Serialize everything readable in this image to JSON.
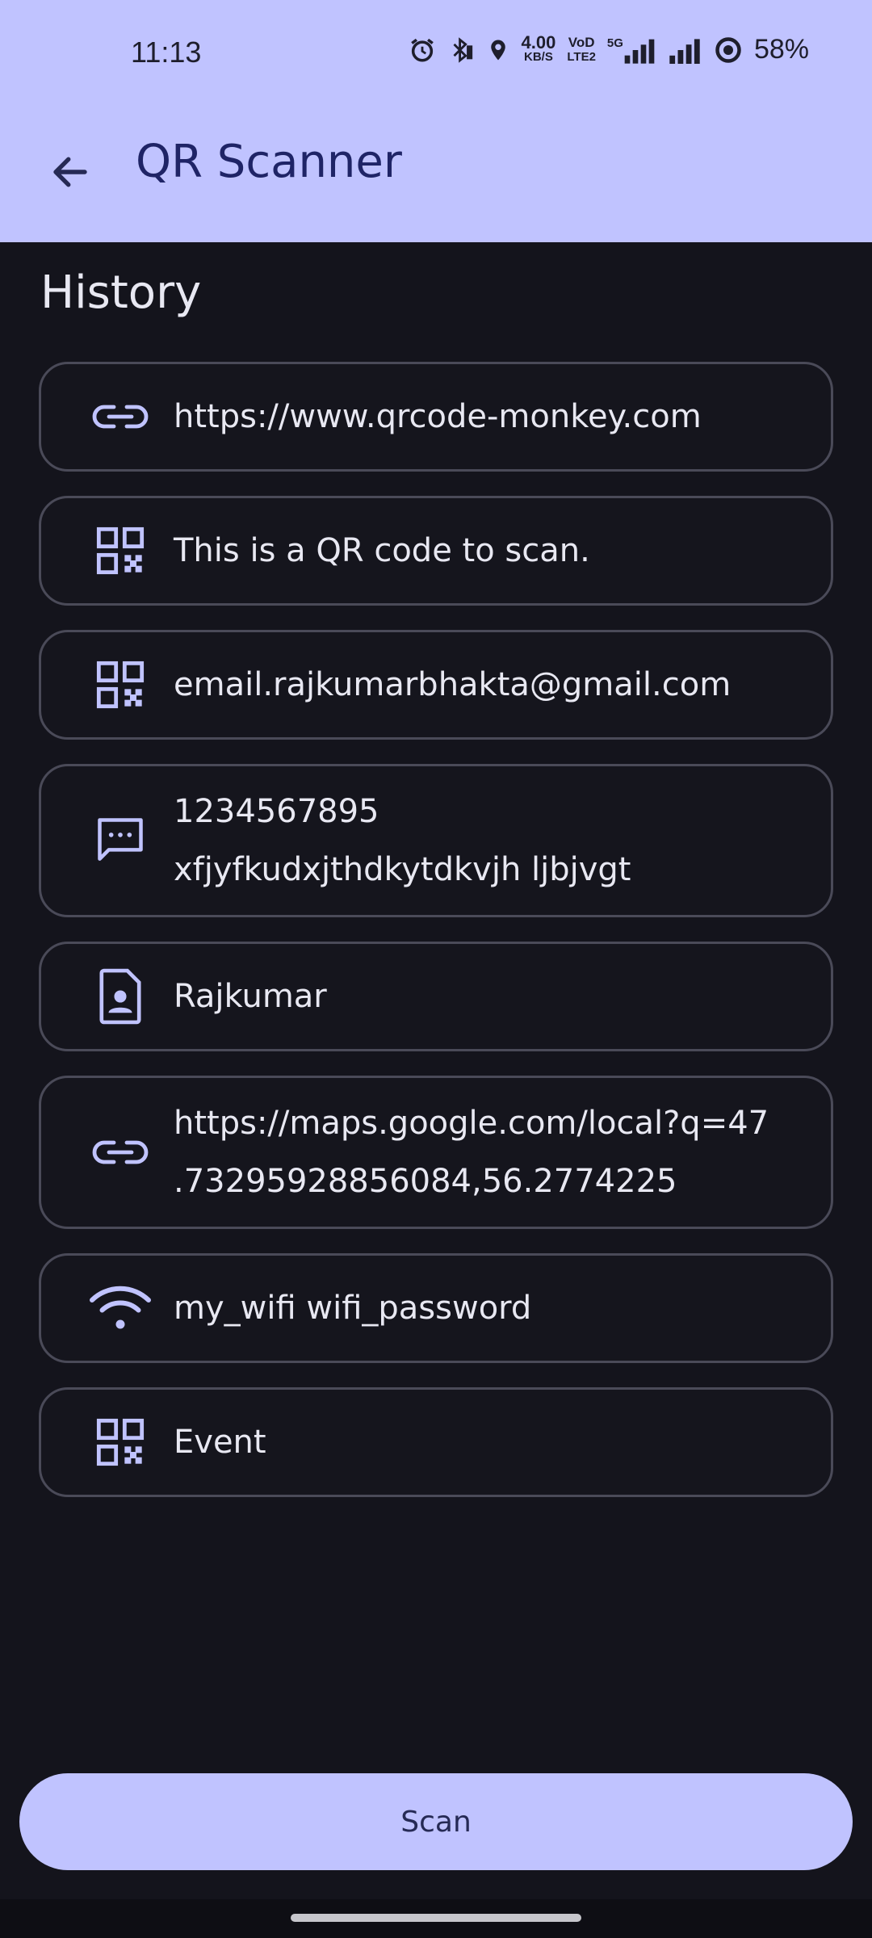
{
  "status_bar": {
    "time": "11:13",
    "net_speed_top": "4.00",
    "net_speed_bottom": "KB/S",
    "volte_top": "VoD",
    "volte_bottom": "LTE2",
    "net_type": "5G",
    "battery": "58%"
  },
  "app_bar": {
    "title": "QR Scanner",
    "back_icon": "arrow-back-icon"
  },
  "history": {
    "label": "History",
    "items": [
      {
        "icon": "link-icon",
        "text": "https://www.qrcode-monkey.com"
      },
      {
        "icon": "qr-code-icon",
        "text": "This is a QR code to scan."
      },
      {
        "icon": "qr-code-icon",
        "text": "email.rajkumarbhakta@gmail.com"
      },
      {
        "icon": "message-icon",
        "line1": "1234567895",
        "line2": "xfjyfkudxjthdkytdkvjh ljbjvgt"
      },
      {
        "icon": "contact-icon",
        "text": "Rajkumar"
      },
      {
        "icon": "link-icon",
        "line1": "https://maps.google.com/local?q=47",
        "line2": ".73295928856084,56.2774225"
      },
      {
        "icon": "wifi-icon",
        "text": "my_wifi wifi_password"
      },
      {
        "icon": "qr-code-icon",
        "text": "Event"
      }
    ]
  },
  "scan_button": {
    "label": "Scan"
  },
  "colors": {
    "accent": "#c0c3ff",
    "background": "#14141c",
    "border": "#4a4a58",
    "icon": "#c0c3ff"
  }
}
